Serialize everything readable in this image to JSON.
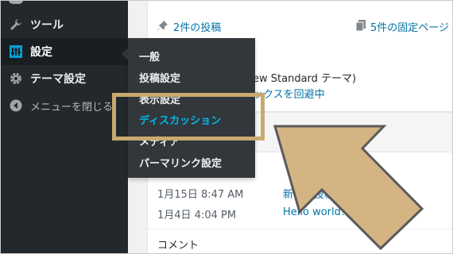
{
  "sidebar": {
    "items": [
      {
        "label": "ツール",
        "icon": "wrench-icon"
      },
      {
        "label": "設定",
        "icon": "settings-icon"
      },
      {
        "label": "テーマ設定",
        "icon": "gear-icon"
      },
      {
        "label": "メニューを閉じる",
        "icon": "collapse-arrow-icon"
      }
    ]
  },
  "flyout": {
    "items": [
      {
        "label": "一般"
      },
      {
        "label": "投稿設定"
      },
      {
        "label": "表示設定"
      },
      {
        "label": "ディスカッション",
        "current": true
      },
      {
        "label": "メディア"
      },
      {
        "label": "パーマリンク設定"
      }
    ]
  },
  "glance": {
    "posts": "2件の投稿",
    "pages": "5件の固定ページ",
    "theme_text": "ew Standard テーマ)",
    "search_text": "ックスを回避中"
  },
  "activity": {
    "rows": [
      {
        "date": "1月15日 8:47 AM",
        "title": "新しい投稿"
      },
      {
        "date": "1月4日 4:04 PM",
        "title": "Hello world!"
      }
    ],
    "comments_heading": "コメント"
  },
  "colors": {
    "sidebar_bg": "#23282d",
    "flyout_bg": "#32373c",
    "current_item": "#00b9eb",
    "highlight": "#c9a96e"
  }
}
